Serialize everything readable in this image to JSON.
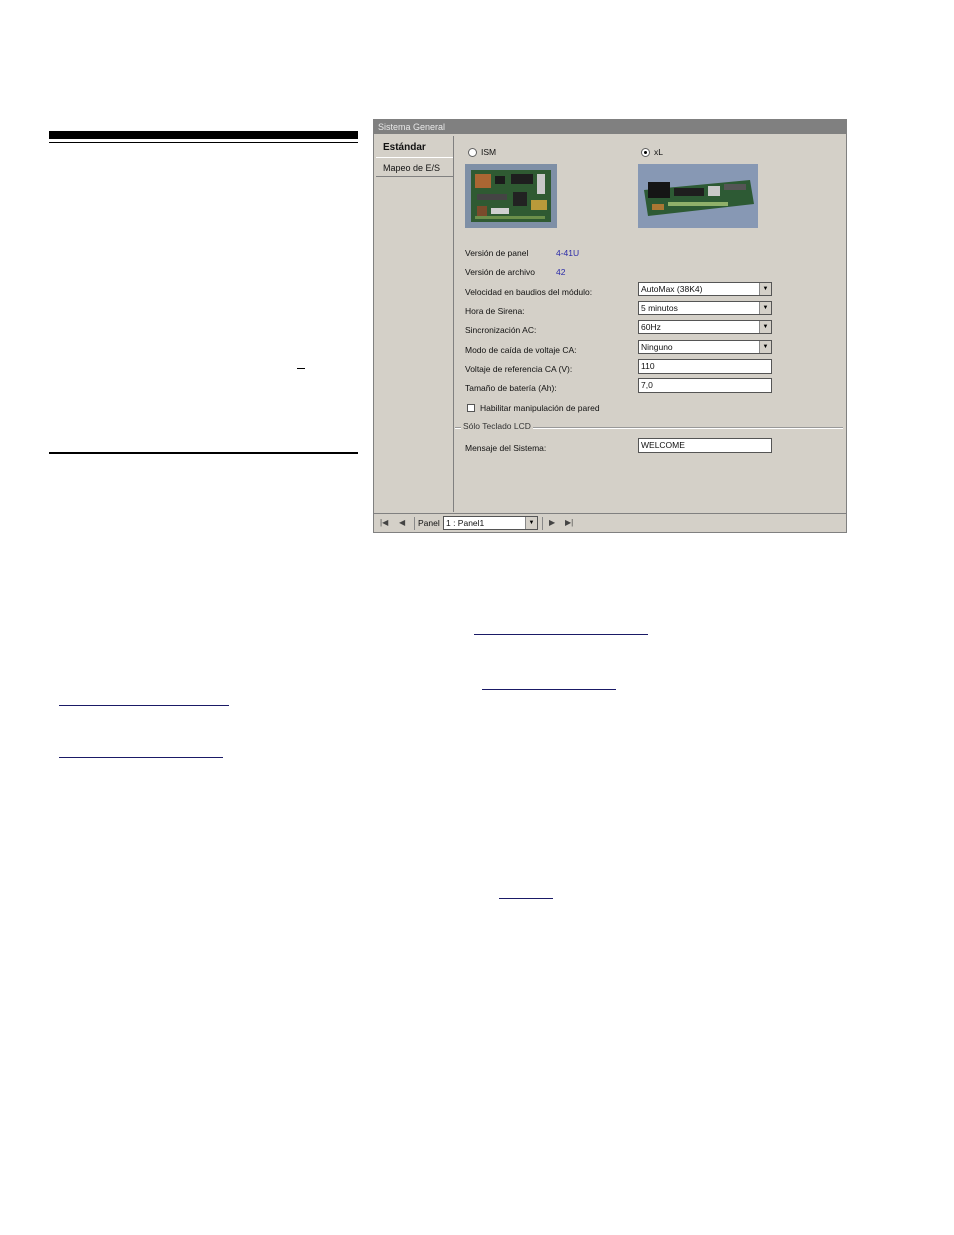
{
  "window": {
    "title": "Sistema General",
    "tabs": [
      {
        "label": "Estándar",
        "active": true
      },
      {
        "label": "Mapeo de E/S",
        "active": false
      }
    ],
    "panel_type": {
      "options": [
        {
          "label": "ISM",
          "selected": false
        },
        {
          "label": "xL",
          "selected": true
        }
      ]
    },
    "info": [
      {
        "label": "Versión de panel",
        "value": "4-41U"
      },
      {
        "label": "Versión de archivo",
        "value": "42"
      }
    ],
    "selects": [
      {
        "label": "Velocidad en baudios del módulo:",
        "value": "AutoMax (38K4)"
      },
      {
        "label": "Hora de Sirena:",
        "value": "5 minutos"
      },
      {
        "label": "Sincronización AC:",
        "value": "60Hz"
      },
      {
        "label": "Modo de caída de voltaje CA:",
        "value": "Ninguno"
      }
    ],
    "inputs": [
      {
        "label": "Voltaje de referencia CA (V):",
        "value": "110"
      },
      {
        "label": "Tamaño de batería (Ah):",
        "value": "7,0"
      }
    ],
    "checkbox": {
      "label": "Habilitar manipulación de pared",
      "checked": false
    },
    "lcd_group": {
      "title": "Sólo Teclado LCD",
      "field_label": "Mensaje del Sistema:",
      "field_value": "WELCOME"
    },
    "statusbar": {
      "panel_label": "Panel",
      "panel_value": "1 : Panel1"
    }
  },
  "colors": {
    "window_bg": "#d4d0c8",
    "titlebar_bg": "#808080",
    "value_text": "#2a2aa8"
  }
}
